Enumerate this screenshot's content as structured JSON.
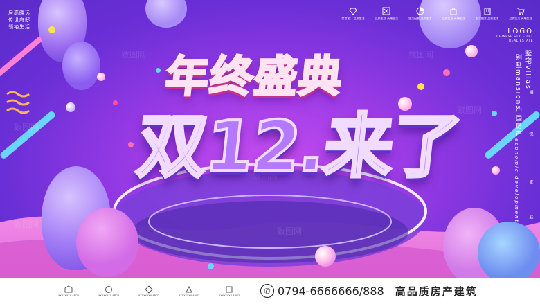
{
  "top_left": {
    "lines": [
      "居高瞻远",
      "传世府邸",
      "领袖生活"
    ]
  },
  "icon_bar": [
    {
      "icon": "diamond-icon",
      "label": "传世名门 品质生活"
    },
    {
      "icon": "x-box-icon",
      "label": "品质生活 高端生活"
    },
    {
      "icon": "pie-icon",
      "label": "生活配套 品质生活"
    },
    {
      "icon": "bag-icon",
      "label": "品质生活 高端生活"
    },
    {
      "icon": "building-icon",
      "label": "生活配套 品质生活"
    },
    {
      "icon": "cart-icon",
      "label": "品质生活 高端生活"
    }
  ],
  "logo": {
    "main": "LOGO",
    "sub1": "CHINESE STYLE LET",
    "sub2": "REAL ESTATE"
  },
  "vertical_texts": {
    "col1": "墅宅Villas",
    "col2": "别墅mansions",
    "col3": "中国房产",
    "col4": "economic development",
    "col5": "相",
    "col6": "悦",
    "col7": "家",
    "col8": "庭"
  },
  "headline": {
    "line1": "年终盛典",
    "line2": "双12.来了"
  },
  "footer": {
    "logos": [
      {
        "icon": "brand-icon",
        "label": "XXXXXXXX ABCD"
      },
      {
        "icon": "brand-icon",
        "label": "XXXXXXXX ABCD"
      },
      {
        "icon": "brand-icon",
        "label": "XXXXXXXX ABCD"
      },
      {
        "icon": "brand-icon",
        "label": "XXXXXXXX ABCD"
      },
      {
        "icon": "brand-icon",
        "label": "XXXXXXXX ABCD"
      }
    ],
    "phone": "0794-6666666/888",
    "slogan": "高品质房产建筑"
  },
  "watermark": "致图网",
  "colors": {
    "bg_center": "#c84df0",
    "bg_edge": "#5a2bc9",
    "title1": "#ff7ec9",
    "title2": "#b479ff"
  }
}
